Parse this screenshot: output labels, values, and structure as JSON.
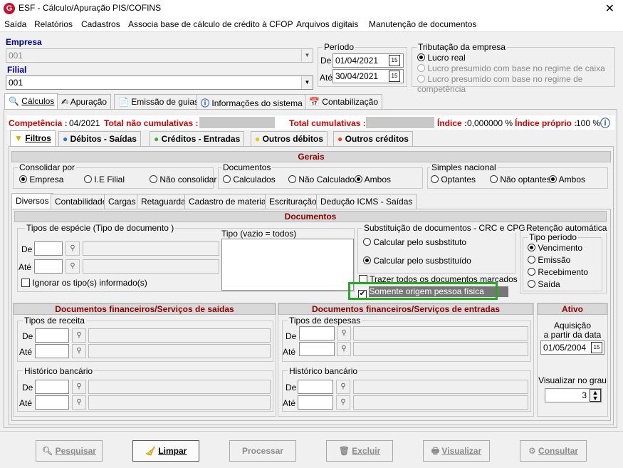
{
  "window": {
    "title": "ESF - Cálculo/Apuração PIS/COFINS",
    "logo": "G",
    "close": "✕"
  },
  "menu": [
    "Saída",
    "Relatórios",
    "Cadastros",
    "Associa base de cálculo de crédito à CFOP",
    "Arquivos digitais",
    "Manutenção de documentos"
  ],
  "empresa": {
    "label": "Empresa",
    "value": "001"
  },
  "filial": {
    "label": "Filial",
    "value": "001"
  },
  "periodo": {
    "label": "Período",
    "de_label": "De",
    "de": "01/04/2021",
    "ate_label": "Até",
    "ate": "30/04/2021"
  },
  "tributacao": {
    "label": "Tributação da empresa",
    "opt1": "Lucro real",
    "opt2": "Lucro presumido com base no regime de caixa",
    "opt3": "Lucro presumido com base no regime de competência"
  },
  "main_tabs": [
    "Cálculos",
    "Apuração",
    "Emissão de guias",
    "Informações do sistema",
    "Contabilização"
  ],
  "status": {
    "competencia_label": "Competência :",
    "competencia": "04/2021",
    "nao_cumul_label": "Total não cumulativas :",
    "cumul_label": "Total cumulativas :",
    "indice_label": "Índice :",
    "indice": "0,000000 %",
    "indice_proprio_label": "Índice próprio :",
    "indice_proprio": "100 %"
  },
  "sub_tabs": [
    "Filtros",
    "Débitos - Saídas",
    "Créditos - Entradas",
    "Outros débitos",
    "Outros créditos"
  ],
  "gerais": {
    "title": "Gerais",
    "consolidar": {
      "label": "Consolidar por",
      "o1": "Empresa",
      "o2": "I.E Filial",
      "o3": "Não consolidar"
    },
    "documentos": {
      "label": "Documentos",
      "o1": "Calculados",
      "o2": "Não Calculados",
      "o3": "Ambos"
    },
    "simples": {
      "label": "Simples nacional",
      "o1": "Optantes",
      "o2": "Não optantes",
      "o3": "Ambos"
    }
  },
  "inner_tabs": [
    "Diversos",
    "Contabilidade",
    "Cargas",
    "Retaguarda",
    "Cadastro de materiais",
    "Escrituração",
    "Dedução ICMS - Saídas"
  ],
  "documentos_sec": {
    "title": "Documentos",
    "tipos_label": "Tipos de espécie (Tipo de documento )",
    "de": "De",
    "ate": "Até",
    "ignorar": "Ignorar os tipo(s) informado(s)",
    "tipo_label": "Tipo (vazio = todos)",
    "subst_label": "Substituição de documentos  - CRC e CPG",
    "subst_o1": "Calcular pelo susbstituto",
    "subst_o2": "Calcular pelo susbstituído",
    "trazer": "Trazer todos os documentos marcados",
    "somente": "Somente origem pessoa física",
    "retencao_label": "Retenção automática",
    "tipo_periodo": "Tipo período",
    "ret_o1": "Vencimento",
    "ret_o2": "Emissão",
    "ret_o3": "Recebimento",
    "ret_o4": "Saída"
  },
  "fin_saidas": {
    "title": "Documentos financeiros/Serviços de saídas",
    "receita": "Tipos de receita",
    "historico": "Histórico bancário",
    "de": "De",
    "ate": "Até"
  },
  "fin_entradas": {
    "title": "Documentos financeiros/Serviços de entradas",
    "despesas": "Tipos de despesas",
    "historico": "Histórico bancário",
    "de": "De",
    "ate": "Até"
  },
  "ativo": {
    "title": "Ativo",
    "aquisicao": "Aquisição",
    "a_partir": "a partir da data",
    "data": "01/05/2004",
    "grau_label": "Visualizar no grau",
    "grau": "3"
  },
  "buttons": {
    "pesquisar": "Pesquisar",
    "limpar": "Limpar",
    "processar": "Processar",
    "excluir": "Excluir",
    "visualizar": "Visualizar",
    "consultar": "Consultar"
  },
  "colors": {
    "red": "#d00000",
    "navy": "#00008b",
    "green_highlight": "#22aa22"
  }
}
